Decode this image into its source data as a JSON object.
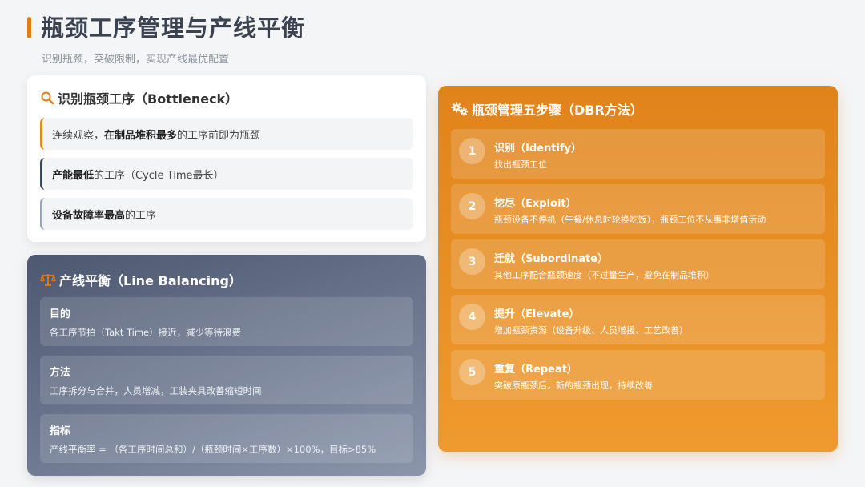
{
  "header": {
    "title": "瓶颈工序管理与产线平衡",
    "subtitle": "识别瓶颈，突破限制，实现产线最优配置"
  },
  "identify": {
    "icon": "search-icon",
    "title": "识别瓶颈工序（Bottleneck）",
    "items": [
      {
        "pre": "连续观察，",
        "bold": "在制品堆积最多",
        "post": "的工序前即为瓶颈"
      },
      {
        "pre": "",
        "bold": "产能最低",
        "post": "的工序（Cycle Time最长）"
      },
      {
        "pre": "",
        "bold": "设备故障率最高",
        "post": "的工序"
      }
    ]
  },
  "balance": {
    "icon": "scale-icon",
    "title": "产线平衡（Line Balancing）",
    "items": [
      {
        "title": "目的",
        "desc": "各工序节拍（Takt Time）接近，减少等待浪费"
      },
      {
        "title": "方法",
        "desc": "工序拆分与合并，人员增减，工装夹具改善缩短时间"
      },
      {
        "title": "指标",
        "desc": "产线平衡率 = （各工序时间总和）/（瓶颈时间×工序数）×100%，目标>85%"
      }
    ]
  },
  "steps": {
    "icon": "gears-icon",
    "title": "瓶颈管理五步骤（DBR方法）",
    "items": [
      {
        "num": "1",
        "title": "识别（Identify）",
        "desc": "找出瓶颈工位"
      },
      {
        "num": "2",
        "title": "挖尽（Exploit）",
        "desc": "瓶颈设备不停机（午餐/休息时轮换吃饭），瓶颈工位不从事非增值活动"
      },
      {
        "num": "3",
        "title": "迁就（Subordinate）",
        "desc": "其他工序配合瓶颈速度（不过量生产，避免在制品堆积）"
      },
      {
        "num": "4",
        "title": "提升（Elevate）",
        "desc": "增加瓶颈资源（设备升级、人员增援、工艺改善）"
      },
      {
        "num": "5",
        "title": "重复（Repeat）",
        "desc": "突破原瓶颈后，新的瓶颈出现，持续改善"
      }
    ]
  },
  "colors": {
    "accent": "#e07d15",
    "navy": "#3d4759",
    "slate": "#9aa4b6"
  }
}
